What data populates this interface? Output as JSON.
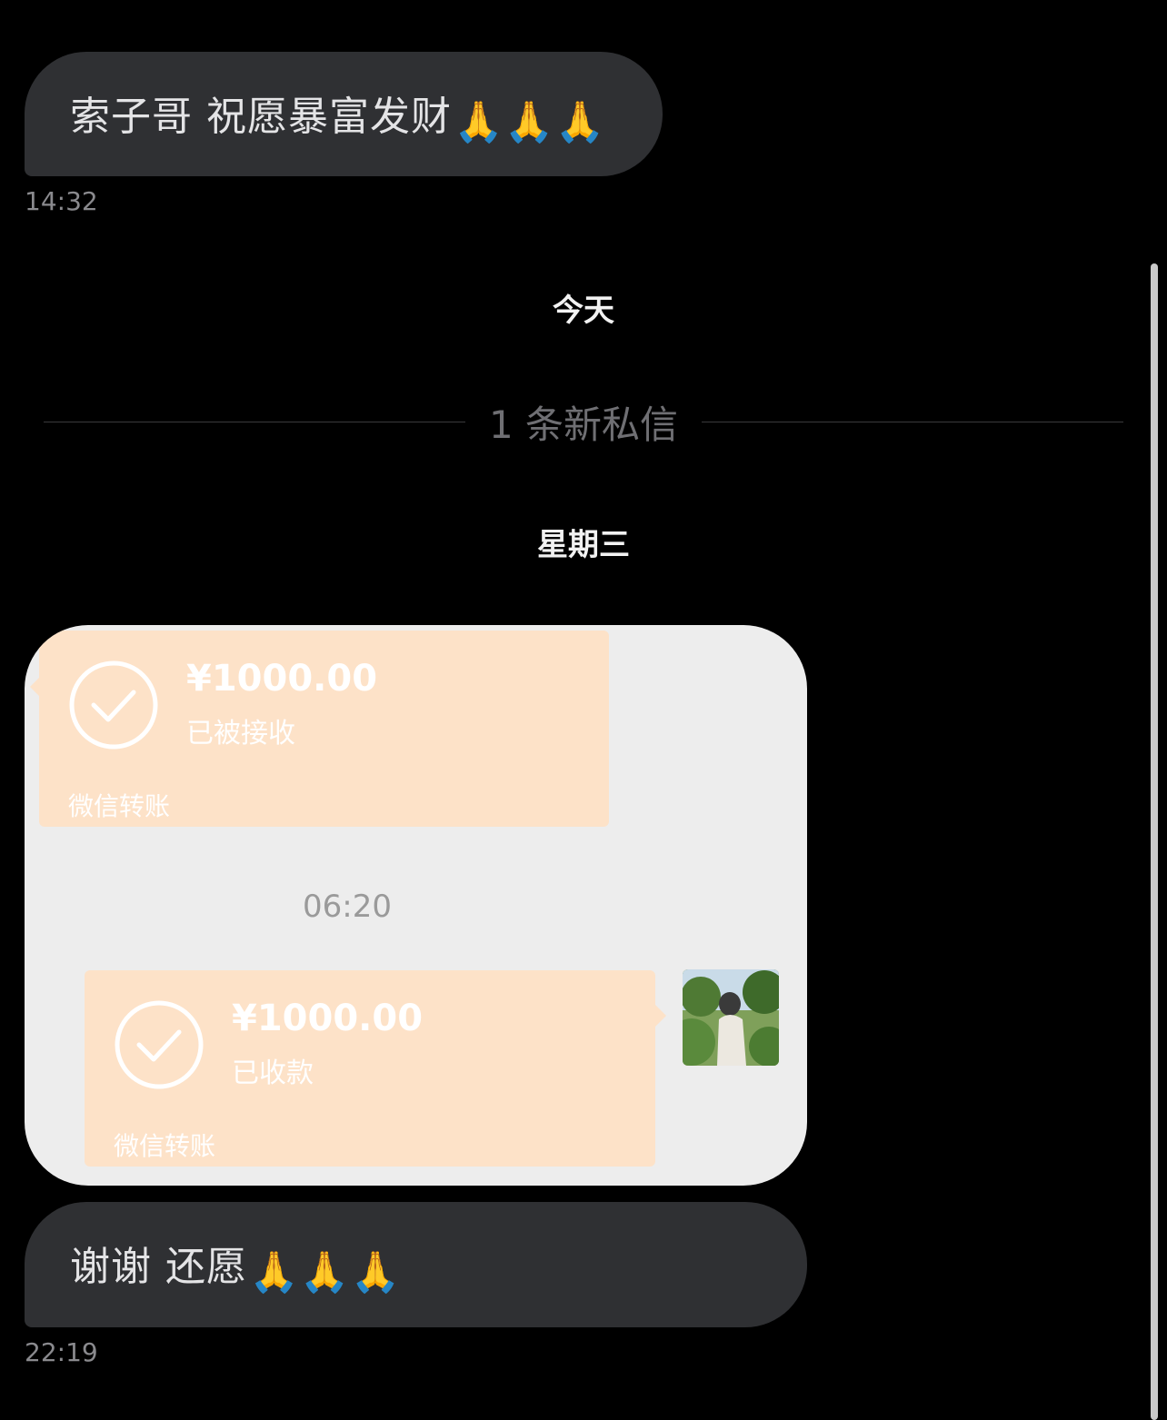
{
  "messages": [
    {
      "text": "索子哥 祝愿暴富发财",
      "emoji": "🙏🙏🙏",
      "time": "14:32"
    },
    {
      "text": "谢谢 还愿",
      "emoji": "🙏🙏🙏",
      "time": "22:19"
    }
  ],
  "separators": {
    "today": "今天",
    "new_messages": "1 条新私信",
    "wednesday": "星期三"
  },
  "screenshot": {
    "transfers": [
      {
        "amount": "¥1000.00",
        "status": "已被接收",
        "label": "微信转账"
      },
      {
        "amount": "¥1000.00",
        "status": "已收款",
        "label": "微信转账"
      }
    ],
    "time": "06:20",
    "avatar_icon": "user-avatar-photo"
  },
  "colors": {
    "background": "#000000",
    "bubble": "#2f3033",
    "transfer_card": "#fde2c8",
    "screenshot_bg": "#ededed"
  }
}
